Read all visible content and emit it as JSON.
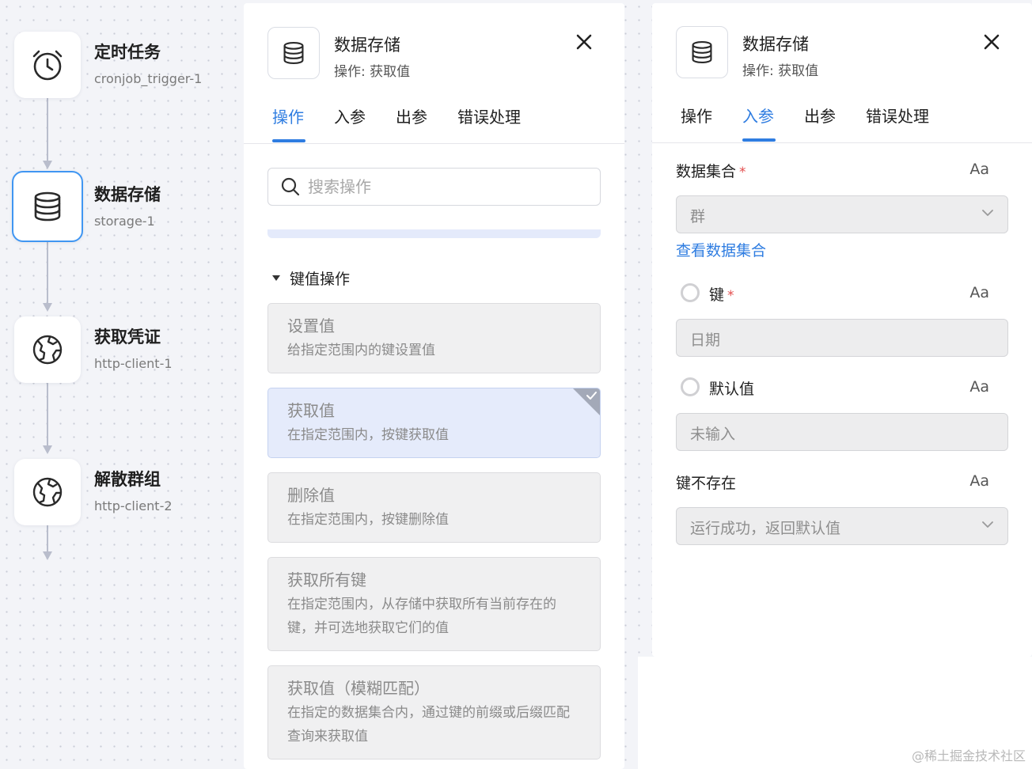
{
  "flow": {
    "nodes": [
      {
        "title": "定时任务",
        "id": "cronjob_trigger-1",
        "icon": "alarm-clock-icon"
      },
      {
        "title": "数据存储",
        "id": "storage-1",
        "icon": "database-icon",
        "selected": true
      },
      {
        "title": "获取凭证",
        "id": "http-client-1",
        "icon": "globe-icon"
      },
      {
        "title": "解散群组",
        "id": "http-client-2",
        "icon": "globe-icon"
      }
    ]
  },
  "operation_panel": {
    "title": "数据存储",
    "subtitle": "操作: 获取值",
    "tabs": [
      "操作",
      "入参",
      "出参",
      "错误处理"
    ],
    "active_tab": "操作",
    "search": {
      "placeholder": "搜索操作",
      "value": ""
    },
    "group": "键值操作",
    "operations": [
      {
        "name": "设置值",
        "desc": "给指定范围内的键设置值"
      },
      {
        "name": "获取值",
        "desc": "在指定范围内，按键获取值",
        "selected": true
      },
      {
        "name": "删除值",
        "desc": "在指定范围内，按键删除值"
      },
      {
        "name": "获取所有键",
        "desc": "在指定范围内，从存储中获取所有当前存在的键，并可选地获取它们的值"
      },
      {
        "name": "获取值（模糊匹配）",
        "desc": "在指定的数据集合内，通过键的前缀或后缀匹配查询来获取值"
      }
    ]
  },
  "param_panel": {
    "title": "数据存储",
    "subtitle": "操作: 获取值",
    "tabs": [
      "操作",
      "入参",
      "出参",
      "错误处理"
    ],
    "active_tab": "入参",
    "dataset": {
      "label": "数据集合",
      "required_mark": "*",
      "type_toggle": "Aa",
      "value": "群"
    },
    "view_dataset_link": "查看数据集合",
    "key": {
      "label": "键",
      "required_mark": "*",
      "type_toggle": "Aa",
      "value": "日期"
    },
    "default_value": {
      "label": "默认值",
      "type_toggle": "Aa",
      "value": "未输入"
    },
    "key_missing": {
      "label": "键不存在",
      "type_toggle": "Aa",
      "value": "运行成功，返回默认值"
    }
  },
  "watermark": "@稀土掘金技术社区",
  "colors": {
    "accent": "#2f7de1",
    "selected_border": "#4096f2",
    "required": "#e34d4d"
  }
}
